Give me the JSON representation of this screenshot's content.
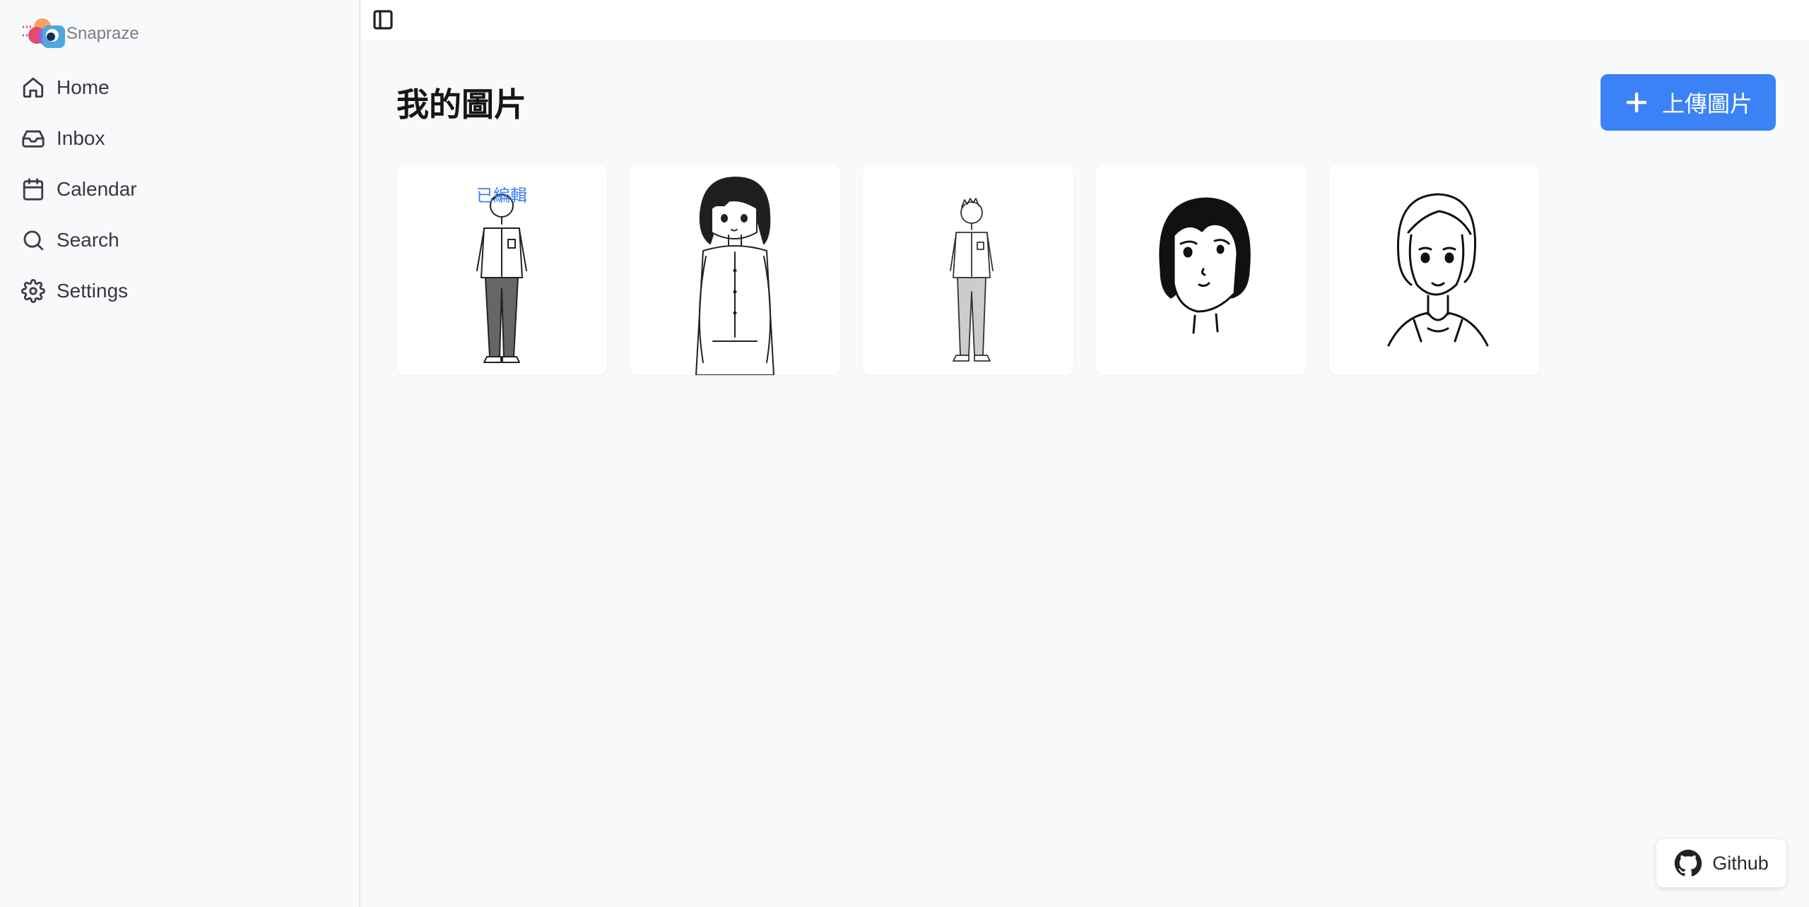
{
  "brand": {
    "name": "Snapraze",
    "logo_icon": "snapraze-logo"
  },
  "sidebar": {
    "items": [
      {
        "label": "Home",
        "icon": "home-icon"
      },
      {
        "label": "Inbox",
        "icon": "inbox-icon"
      },
      {
        "label": "Calendar",
        "icon": "calendar-icon"
      },
      {
        "label": "Search",
        "icon": "search-icon"
      },
      {
        "label": "Settings",
        "icon": "gear-icon"
      }
    ]
  },
  "topbar": {
    "toggle_icon": "sidebar-toggle-icon"
  },
  "main": {
    "title": "我的圖片",
    "upload_label": "上傳圖片",
    "upload_icon": "plus-icon",
    "images": [
      {
        "badge": "已編輯",
        "subject": "standing boy sketch"
      },
      {
        "badge": "",
        "subject": "girl in blouse sketch"
      },
      {
        "badge": "",
        "subject": "standing boy sketch"
      },
      {
        "badge": "",
        "subject": "bob hair girl portrait"
      },
      {
        "badge": "",
        "subject": "smiling girl portrait"
      }
    ]
  },
  "github": {
    "label": "Github",
    "icon": "github-icon"
  },
  "colors": {
    "accent": "#3b82f6",
    "background": "#f8f9fb",
    "card": "#ffffff"
  }
}
